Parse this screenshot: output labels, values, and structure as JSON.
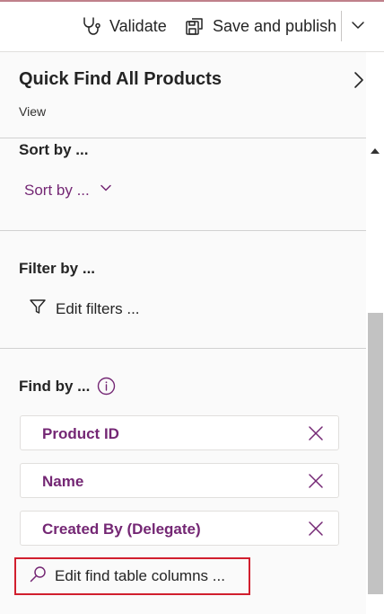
{
  "toolbar": {
    "validate_label": "Validate",
    "save_publish_label": "Save and publish"
  },
  "panel": {
    "title": "Quick Find All Products",
    "subtitle": "View"
  },
  "sort_section": {
    "title": "Sort by ...",
    "dropdown_label": "Sort by ..."
  },
  "filter_section": {
    "title": "Filter by ...",
    "edit_label": "Edit filters ..."
  },
  "find_section": {
    "title": "Find by ...",
    "columns": [
      {
        "label": "Product ID"
      },
      {
        "label": "Name"
      },
      {
        "label": "Created By (Delegate)"
      }
    ],
    "edit_label": "Edit find table columns ..."
  },
  "colors": {
    "accent_purple": "#742774",
    "highlight_red": "#d11f2e",
    "text": "#242424"
  },
  "icons": [
    "stethoscope-icon",
    "save-publish-icon",
    "chevron-down-icon",
    "chevron-right-icon",
    "filter-icon",
    "info-icon",
    "close-icon",
    "search-icon",
    "scroll-up-icon"
  ]
}
